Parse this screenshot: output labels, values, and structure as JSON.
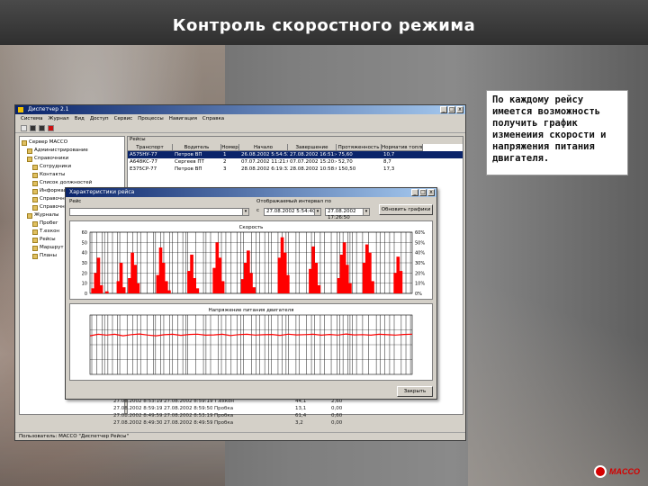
{
  "slide": {
    "title": "Контроль скоростного режима",
    "note": "По каждому рейсу имеется возможность получить график изменеиия скорости и напряжения питания двигателя.",
    "logo_text": "MACCO",
    "accent_color": "#d40000"
  },
  "app": {
    "title": "Диспетчер 2.1",
    "menu": [
      "Система",
      "Журнал",
      "Вид",
      "Доступ",
      "Сервис",
      "Процессы",
      "Навигация",
      "Справка"
    ],
    "toolbar_icons": [
      "tree-icon",
      "back-icon",
      "forward-icon",
      "stop-icon"
    ],
    "tree": [
      "Сервер МАССО",
      "Администрирование",
      "Справочники",
      "Сотрудники",
      "Контакты",
      "Список должностей",
      "Информация о документах",
      "Справочник",
      "Справочник",
      "Журналы",
      "Пробег",
      "Т.ехкон",
      "Рейсы",
      "Маршрут",
      "Планы"
    ],
    "trips_caption": "Рейсы",
    "columns": [
      "Транспорт",
      "Водитель",
      "Номер",
      "Начало",
      "Завершение",
      "Протяженность",
      "Норматив топлива"
    ],
    "rows": [
      {
        "transport": "А575НУ-77",
        "driver": "Петров ВП",
        "number": "1",
        "start": "26.08.2002 5:54:53",
        "end": "27.08.2002 16:51:40",
        "length": "75,60",
        "fuel": "10,7",
        "selected": true
      },
      {
        "transport": "А648КС-77",
        "driver": "Сергеев ПТ",
        "number": "2",
        "start": "07.07.2002 11:21:09",
        "end": "07.07.2002 15:20:44",
        "length": "52,70",
        "fuel": "8,7",
        "selected": false
      },
      {
        "transport": "Е375СР-77",
        "driver": "Петров ВП",
        "number": "3",
        "start": "28.08.2002 6:19:32",
        "end": "28.08.2002 10:58:06",
        "length": "150,50",
        "fuel": "17,3",
        "selected": false
      }
    ],
    "bottom_rows": [
      {
        "start": "27.08.2002 8:53:19",
        "end": "27.08.2002 8:59:19",
        "name": "Т.ехкон",
        "speed": "44,1",
        "length": "2,60"
      },
      {
        "start": "27.08.2002 8:59:19",
        "end": "27.08.2002 8:59:50",
        "name": "Пробка",
        "speed": "13,1",
        "length": "0,00"
      },
      {
        "start": "27.08.2002 8:49:59",
        "end": "27.08.2002 8:53:19",
        "name": "Пробка",
        "speed": "61,4",
        "length": "0,60"
      },
      {
        "start": "27.08.2002 8:49:30",
        "end": "27.08.2002 8:49:59",
        "name": "Пробка",
        "speed": "3,2",
        "length": "0,00"
      }
    ],
    "status": "Пользователь: МАССО \"Диспетчер Рейсы\""
  },
  "trip_window": {
    "title": "Характеристики рейса",
    "label_trip": "Рейс",
    "label_interval": "Отображаемый интервал",
    "label_from": "с",
    "label_to": "по",
    "interval_from": "27.08.2002 5:54:40",
    "interval_to": "27.08.2002 17:26:50",
    "refresh_button": "Обновить графики",
    "close_button": "Закрыть",
    "win_buttons": [
      "_",
      "□",
      "x"
    ]
  },
  "chart_data": [
    {
      "type": "area",
      "title": "Скорость",
      "ylim": [
        0,
        60
      ],
      "y_ticks": [
        0,
        10,
        20,
        30,
        40,
        50,
        60
      ],
      "y_ticks_right": [
        "0%",
        "10%",
        "20%",
        "30%",
        "40%",
        "50%",
        "60%"
      ],
      "grid": true,
      "series": [
        {
          "color": "#ff0000",
          "values": [
            0,
            5,
            20,
            35,
            8,
            0,
            2,
            0,
            0,
            0,
            12,
            30,
            6,
            0,
            15,
            40,
            28,
            10,
            0,
            0,
            0,
            0,
            0,
            0,
            18,
            45,
            30,
            12,
            3,
            0,
            0,
            0,
            0,
            0,
            0,
            22,
            38,
            15,
            5,
            0,
            0,
            0,
            0,
            0,
            25,
            50,
            35,
            12,
            0,
            0,
            0,
            0,
            0,
            0,
            14,
            30,
            42,
            20,
            6,
            0,
            0,
            0,
            0,
            0,
            0,
            0,
            0,
            35,
            55,
            40,
            18,
            0,
            0,
            0,
            0,
            0,
            0,
            0,
            24,
            46,
            30,
            8,
            0,
            0,
            0,
            0,
            0,
            0,
            15,
            38,
            50,
            28,
            10,
            0,
            0,
            0,
            0,
            30,
            48,
            40,
            12,
            0,
            0,
            0,
            0,
            0,
            0,
            0,
            20,
            36,
            22,
            0,
            0,
            0,
            0
          ]
        }
      ]
    },
    {
      "type": "line",
      "title": "Напряжение питания двигателя",
      "ylim": [
        0,
        40
      ],
      "grid": true,
      "series": [
        {
          "color": "#ff0000",
          "values": [
            26,
            27,
            26.5,
            27,
            26,
            26.8,
            27.2,
            26.5,
            26,
            26.7,
            27,
            26.3,
            26.9,
            27.1,
            26.4,
            26.6,
            27,
            26.2,
            26.8,
            27,
            26.5,
            26.7,
            26.9,
            26.3,
            27.1,
            26.6,
            26.8,
            27,
            26.4,
            26.9,
            26.5,
            27.2,
            26.6,
            26.8,
            26.4,
            27,
            26.7,
            26.5,
            26.9,
            27.1
          ]
        }
      ]
    }
  ]
}
